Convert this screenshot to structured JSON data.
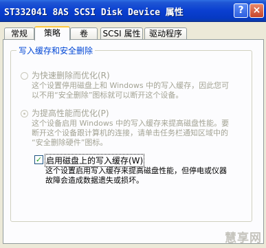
{
  "window": {
    "title": "ST332041 8AS SCSI Disk Device 属性",
    "help_glyph": "?",
    "close_glyph": "×"
  },
  "tabs": [
    {
      "label": "常规",
      "active": false
    },
    {
      "label": "策略",
      "active": true
    },
    {
      "label": "卷",
      "active": false
    },
    {
      "label": "SCSI 属性",
      "active": false
    },
    {
      "label": "驱动程序",
      "active": false
    }
  ],
  "group": {
    "title": "写入缓存和安全删除",
    "option_quick": {
      "label": "为快速删除而优化(R)",
      "desc_line1": "这个设置停用磁盘上和 Windows 中的写入缓存，因此您可",
      "desc_line2": "以不用“安全删除”图标就可以断开这个设备。",
      "selected": false,
      "enabled": false
    },
    "option_perf": {
      "label": "为提高性能而优化(P)",
      "desc_line1": "这个设备启用 Windows 中的写入缓存来提高磁盘性能。要",
      "desc_line2": "断开这个设备跟计算机的连接，请单击任务栏通知区域中的",
      "desc_line3": "“安全删除硬件”图标。",
      "selected": true,
      "enabled": false
    },
    "write_cache": {
      "label": "启用磁盘上的写入缓存(W)",
      "checked": true,
      "desc_line1": "这个设置启用写入缓存来提高磁盘性能，但停电或仪器",
      "desc_line2": "故障会造成数据遗失或损坏。"
    }
  },
  "watermark": "慧享网",
  "colors": {
    "title_bar": "#0a3fd0",
    "group_title": "#0046d5",
    "disabled_text": "#a3a394",
    "active_tab_highlight": "#ffc83c"
  }
}
